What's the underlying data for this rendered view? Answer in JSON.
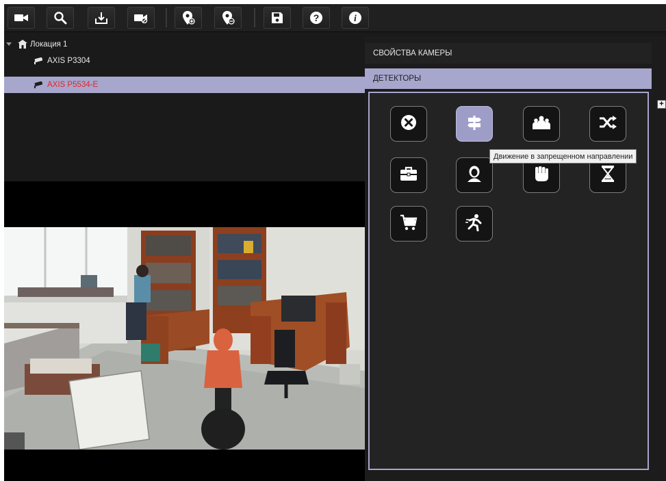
{
  "toolbar": {
    "buttons": [
      {
        "name": "camera-add-icon"
      },
      {
        "name": "search-icon"
      },
      {
        "name": "download-icon"
      },
      {
        "name": "camera-disabled-icon"
      },
      {
        "name": "location-add-icon"
      },
      {
        "name": "location-remove-icon"
      },
      {
        "name": "save-icon"
      },
      {
        "name": "help-icon"
      },
      {
        "name": "info-icon"
      }
    ]
  },
  "tree": {
    "location": {
      "label": "Локация 1",
      "icon": "location-icon"
    },
    "cameras": [
      {
        "label": "AXIS P3304",
        "icon": "camera-icon",
        "selected": false
      },
      {
        "label": "AXIS P5534-E",
        "icon": "camera-icon",
        "selected": true
      }
    ]
  },
  "panel": {
    "camera_properties_label": "СВОЙСТВА КАМЕРЫ",
    "detectors_label": "ДЕТЕКТОРЫ",
    "add_button_label": "+",
    "tooltip": "Движение в запрещенном направлении"
  },
  "detectors": [
    {
      "icon": "close-icon",
      "active": false
    },
    {
      "icon": "direction-sign-icon",
      "active": true
    },
    {
      "icon": "crowd-icon",
      "active": false
    },
    {
      "icon": "shuffle-icon",
      "active": false
    },
    {
      "icon": "briefcase-icon",
      "active": false
    },
    {
      "icon": "face-icon",
      "active": false
    },
    {
      "icon": "fist-icon",
      "active": false
    },
    {
      "icon": "hourglass-icon",
      "active": false
    },
    {
      "icon": "cart-icon",
      "active": false
    },
    {
      "icon": "running-man-icon",
      "active": false
    }
  ],
  "colors": {
    "accent": "#a7a6cc",
    "selected_text": "#e0262b",
    "background": "#1a1a1a"
  }
}
